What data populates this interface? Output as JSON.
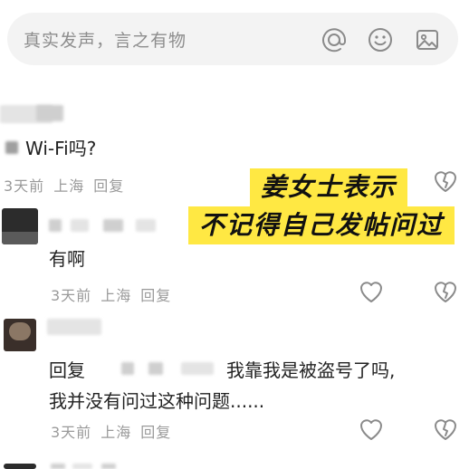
{
  "input": {
    "placeholder": "真实发声，言之有物"
  },
  "icons": [
    "at-icon",
    "emoji-icon",
    "image-icon",
    "heart-icon",
    "broken-heart-icon"
  ],
  "comments": [
    {
      "text": "Wi-Fi吗?",
      "time": "3天前",
      "location": "上海",
      "reply": "回复"
    },
    {
      "text": "有啊",
      "time": "3天前",
      "location": "上海",
      "reply": "回复"
    },
    {
      "reply_prefix": "回复",
      "text_line1": "我靠我是被盗号了吗,",
      "text_line2": "我并没有问过这种问题......",
      "time": "3天前",
      "location": "上海",
      "reply": "回复"
    }
  ],
  "banner": {
    "line1": "姜女士表示",
    "line2": "不记得自己发帖问过"
  },
  "colors": {
    "banner_bg": "#ffe843",
    "meta_text": "#9a9a9a",
    "input_bg": "#f3f3f3"
  }
}
